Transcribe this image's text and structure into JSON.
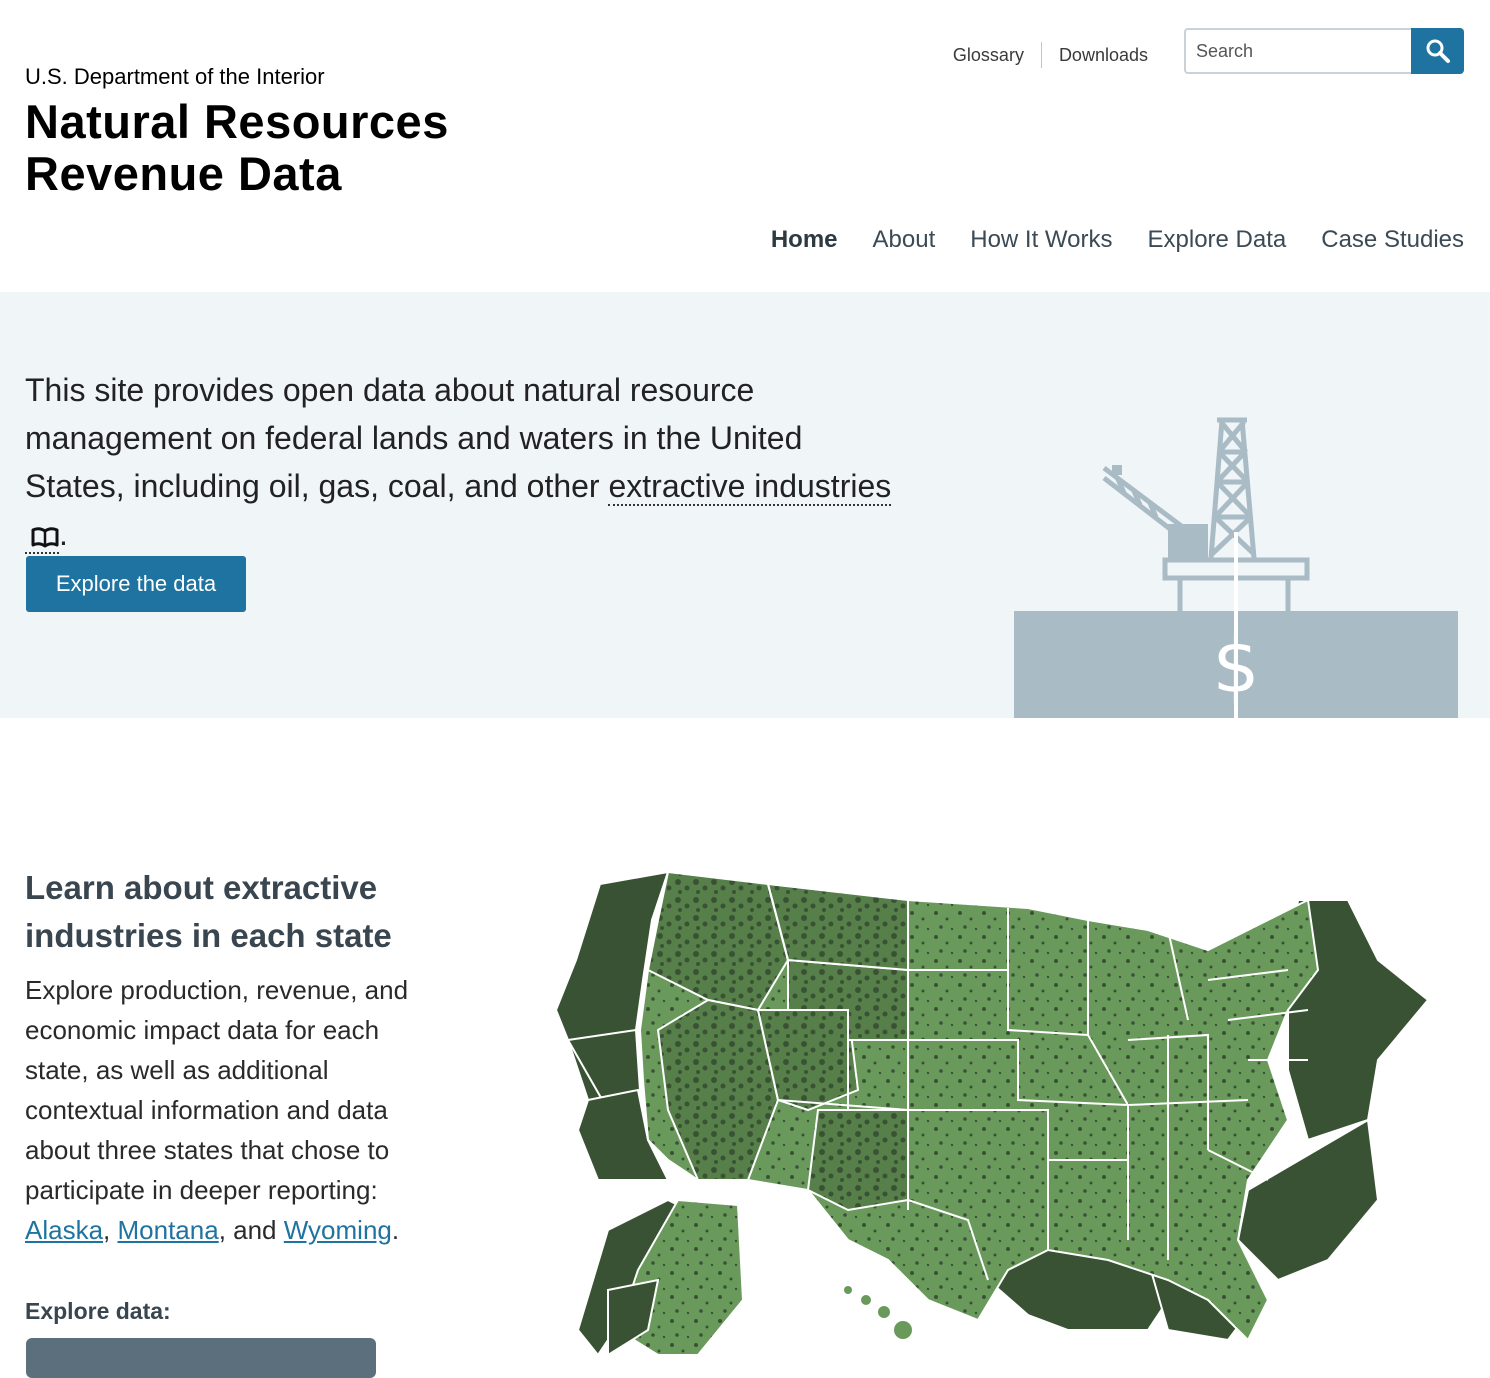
{
  "header": {
    "agency": "U.S. Department of the Interior",
    "title_line1": "Natural Resources",
    "title_line2": "Revenue Data",
    "utility_links": [
      "Glossary",
      "Downloads"
    ],
    "search": {
      "placeholder": "Search"
    },
    "nav": [
      "Home",
      "About",
      "How It Works",
      "Explore Data",
      "Case Studies"
    ],
    "active_nav": "Home"
  },
  "hero": {
    "text_before": "This site provides open data about natural resource management on federal lands and waters in the United States, including oil, gas, coal, and other ",
    "glossary_term": "extractive industries",
    "text_after": ".",
    "button": "Explore the data",
    "illustration_symbol": "$"
  },
  "states_section": {
    "title": "Learn about extractive industries in each state",
    "body_before": "Explore production, revenue, and economic impact data for each state, as well as additional contextual information and data about three states that chose to participate in deeper reporting: ",
    "links": [
      "Alaska",
      "Montana",
      "Wyoming"
    ],
    "sep1": ", ",
    "sep2": ", and ",
    "body_after": ".",
    "explore_label": "Explore data:"
  },
  "colors": {
    "accent": "#1f73a0",
    "hero_bg": "#f0f5f8",
    "map_dark": "#3a5234",
    "map_light": "#6a9a5b"
  }
}
